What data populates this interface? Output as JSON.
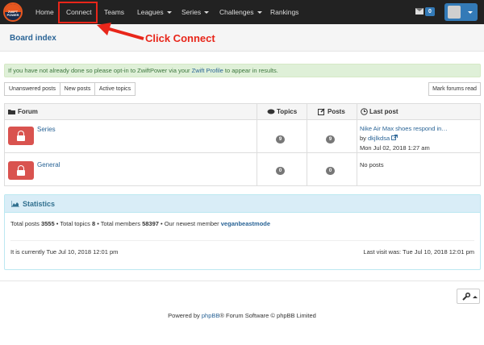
{
  "navbar": {
    "logo_text": "ZWIFT POWER",
    "items": [
      {
        "label": "Home",
        "dropdown": false
      },
      {
        "label": "Connect",
        "dropdown": false
      },
      {
        "label": "Teams",
        "dropdown": false
      },
      {
        "label": "Leagues",
        "dropdown": true
      },
      {
        "label": "Series",
        "dropdown": true
      },
      {
        "label": "Challenges",
        "dropdown": true
      },
      {
        "label": "Rankings",
        "dropdown": false
      }
    ],
    "messages_count": "0",
    "mail_icon": "envelope-icon",
    "user_icon": "avatar"
  },
  "breadcrumb": {
    "label": "Board index"
  },
  "annotation": {
    "text": "Click Connect",
    "color": "#e8261a"
  },
  "notice": {
    "prefix": "If you have not already done so please opt-in to ZwiftPower via your ",
    "link": "Zwift Profile",
    "suffix": " to appear in results."
  },
  "actions": {
    "unanswered": "Unanswered posts",
    "new_posts": "New posts",
    "active": "Active topics",
    "mark_read": "Mark forums read"
  },
  "table": {
    "headers": {
      "forum": "Forum",
      "topics": "Topics",
      "posts": "Posts",
      "last_post": "Last post"
    },
    "rows": [
      {
        "name": "Series",
        "topics": "9",
        "posts": "9",
        "last_title": "Nike Air Max shoes respond in…",
        "last_by_prefix": "by",
        "last_by": "dkjlkdsa",
        "last_date": "Mon Jul 02, 2018 1:27 am"
      },
      {
        "name": "General",
        "topics": "0",
        "posts": "0",
        "last_title": "No posts"
      }
    ]
  },
  "statistics": {
    "title": "Statistics",
    "total_posts_label": "Total posts",
    "total_posts": "3555",
    "total_topics_label": "Total topics",
    "total_topics": "8",
    "total_members_label": "Total members",
    "total_members": "58397",
    "newest_label": "Our newest member",
    "newest_member": "veganbeastmode",
    "current_time": "It is currently Tue Jul 10, 2018 12:01 pm",
    "last_visit": "Last visit was: Tue Jul 10, 2018 12:01 pm"
  },
  "footer": {
    "prefix": "Powered by ",
    "link": "phpBB",
    "suffix": "® Forum Software © phpBB Limited"
  },
  "colors": {
    "navbar": "#222222",
    "link": "#2a6496",
    "accent": "#337ab7",
    "lock": "#d9534f",
    "highlight": "#e8261a"
  }
}
